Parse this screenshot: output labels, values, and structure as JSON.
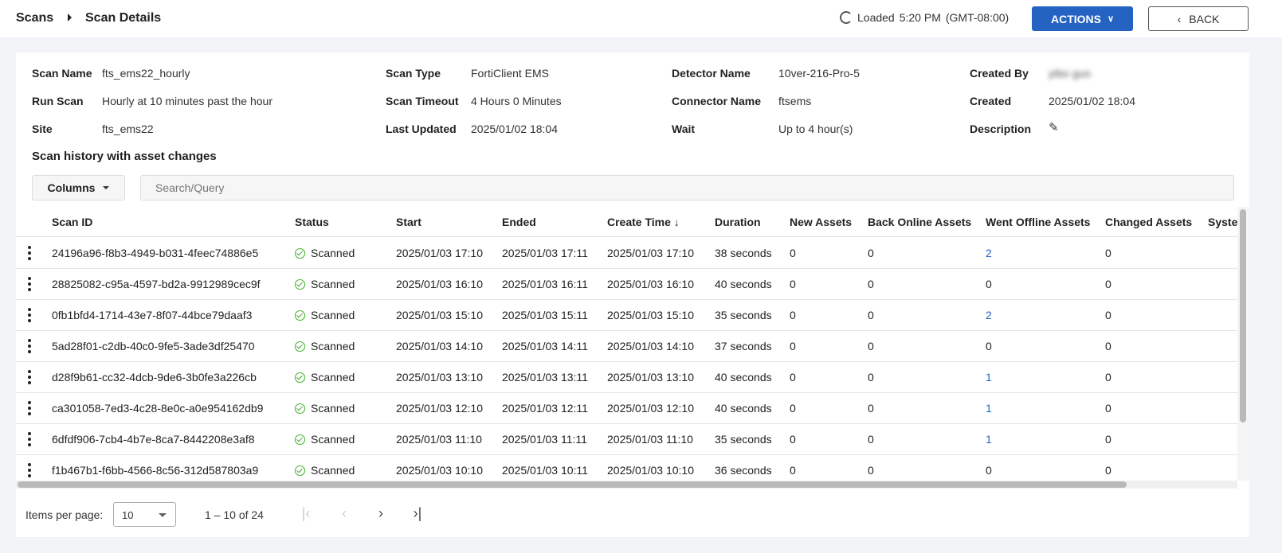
{
  "breadcrumb": {
    "root": "Scans",
    "current": "Scan Details"
  },
  "header": {
    "loaded_label": "Loaded",
    "loaded_time": "5:20 PM",
    "timezone": "(GMT-08:00)",
    "actions_label": "ACTIONS",
    "back_label": "BACK"
  },
  "details": {
    "scan_name": {
      "label": "Scan Name",
      "value": "fts_ems22_hourly"
    },
    "run_scan": {
      "label": "Run Scan",
      "value": "Hourly at 10 minutes past the hour"
    },
    "site": {
      "label": "Site",
      "value": "fts_ems22"
    },
    "scan_type": {
      "label": "Scan Type",
      "value": "FortiClient EMS"
    },
    "scan_timeout": {
      "label": "Scan Timeout",
      "value": "4 Hours 0 Minutes"
    },
    "last_updated": {
      "label": "Last Updated",
      "value": "2025/01/02 18:04"
    },
    "detector_name": {
      "label": "Detector Name",
      "value": "10ver-216-Pro-5"
    },
    "connector_name": {
      "label": "Connector Name",
      "value": "ftsems"
    },
    "wait": {
      "label": "Wait",
      "value": "Up to 4 hour(s)"
    },
    "created_by": {
      "label": "Created By",
      "value": "yibo guo"
    },
    "created": {
      "label": "Created",
      "value": "2025/01/02 18:04"
    },
    "description": {
      "label": "Description"
    }
  },
  "history": {
    "title": "Scan history with asset changes",
    "columns_label": "Columns",
    "search_placeholder": "Search/Query",
    "headers": [
      "Scan ID",
      "Status",
      "Start",
      "Ended",
      "Create Time",
      "Duration",
      "New Assets",
      "Back Online Assets",
      "Went Offline Assets",
      "Changed Assets",
      "System"
    ],
    "rows": [
      [
        "24196a96-f8b3-4949-b031-4feec74886e5",
        "Scanned",
        "2025/01/03 17:10",
        "2025/01/03 17:11",
        "2025/01/03 17:10",
        "38 seconds",
        "0",
        "0",
        "2",
        "0"
      ],
      [
        "28825082-c95a-4597-bd2a-9912989cec9f",
        "Scanned",
        "2025/01/03 16:10",
        "2025/01/03 16:11",
        "2025/01/03 16:10",
        "40 seconds",
        "0",
        "0",
        "0",
        "0"
      ],
      [
        "0fb1bfd4-1714-43e7-8f07-44bce79daaf3",
        "Scanned",
        "2025/01/03 15:10",
        "2025/01/03 15:11",
        "2025/01/03 15:10",
        "35 seconds",
        "0",
        "0",
        "2",
        "0"
      ],
      [
        "5ad28f01-c2db-40c0-9fe5-3ade3df25470",
        "Scanned",
        "2025/01/03 14:10",
        "2025/01/03 14:11",
        "2025/01/03 14:10",
        "37 seconds",
        "0",
        "0",
        "0",
        "0"
      ],
      [
        "d28f9b61-cc32-4dcb-9de6-3b0fe3a226cb",
        "Scanned",
        "2025/01/03 13:10",
        "2025/01/03 13:11",
        "2025/01/03 13:10",
        "40 seconds",
        "0",
        "0",
        "1",
        "0"
      ],
      [
        "ca301058-7ed3-4c28-8e0c-a0e954162db9",
        "Scanned",
        "2025/01/03 12:10",
        "2025/01/03 12:11",
        "2025/01/03 12:10",
        "40 seconds",
        "0",
        "0",
        "1",
        "0"
      ],
      [
        "6dfdf906-7cb4-4b7e-8ca7-8442208e3af8",
        "Scanned",
        "2025/01/03 11:10",
        "2025/01/03 11:11",
        "2025/01/03 11:10",
        "35 seconds",
        "0",
        "0",
        "1",
        "0"
      ],
      [
        "f1b467b1-f6bb-4566-8c56-312d587803a9",
        "Scanned",
        "2025/01/03 10:10",
        "2025/01/03 10:11",
        "2025/01/03 10:10",
        "36 seconds",
        "0",
        "0",
        "0",
        "0"
      ]
    ]
  },
  "pagination": {
    "items_per_page_label": "Items per page:",
    "items_per_page": "10",
    "range": "1 – 10 of 24"
  }
}
